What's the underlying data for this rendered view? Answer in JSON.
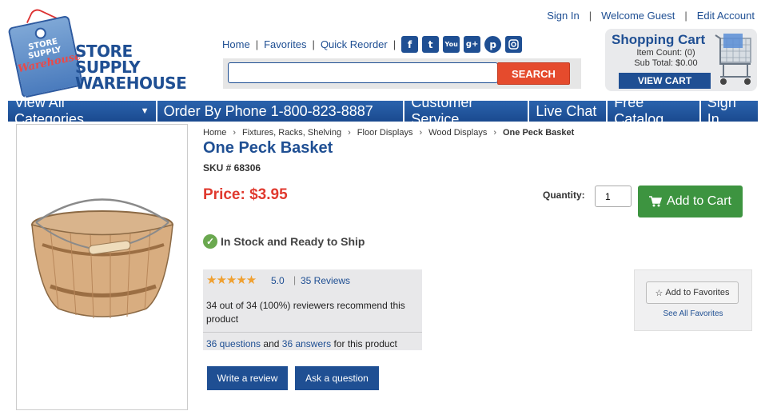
{
  "top_links": {
    "sign_in": "Sign In",
    "welcome": "Welcome Guest",
    "edit_account": "Edit Account"
  },
  "logo": {
    "tag_line1": "STORE SUPPLY",
    "tag_line2": "Warehouse",
    "name_line1": "STORE SUPPLY",
    "name_line2": "WAREHOUSE"
  },
  "mid_nav": {
    "home": "Home",
    "favorites": "Favorites",
    "quick_reorder": "Quick Reorder"
  },
  "social": [
    "facebook-icon",
    "twitter-icon",
    "youtube-icon",
    "googleplus-icon",
    "pinterest-icon",
    "instagram-icon"
  ],
  "search": {
    "placeholder": "",
    "button": "SEARCH"
  },
  "cart": {
    "title": "Shopping Cart",
    "item_count": "Item Count: (0)",
    "subtotal": "Sub Total: $0.00",
    "view_button": "VIEW CART"
  },
  "navbar": {
    "categories": "View All Categories",
    "phone": "Order By Phone 1-800-823-8887",
    "customer_service": "Customer Service",
    "live_chat": "Live Chat",
    "free_catalog": "Free Catalog",
    "sign_in": "Sign In"
  },
  "breadcrumb": [
    "Home",
    "Fixtures, Racks, Shelving",
    "Floor Displays",
    "Wood Displays",
    "One Peck Basket"
  ],
  "product": {
    "title": "One Peck Basket",
    "sku": "SKU # 68306",
    "price": "Price: $3.95",
    "quantity_label": "Quantity:",
    "quantity_value": "1",
    "add_to_cart": "Add to Cart",
    "stock": "In Stock and Ready to Ship"
  },
  "reviews": {
    "rating": "5.0",
    "stars_value": 5,
    "count": "35 Reviews",
    "recommend": "34 out of 34 (100%) reviewers recommend this product",
    "questions": "36 questions",
    "and": "and",
    "answers": "36 answers",
    "suffix": "for this product"
  },
  "actions": {
    "write_review": "Write a review",
    "ask_question": "Ask a question"
  },
  "favorites": {
    "add": "Add to Favorites",
    "see_all": "See All Favorites"
  },
  "colors": {
    "brand_blue": "#1f4f93",
    "price_red": "#e03a2f",
    "search_red": "#e54b2d",
    "cart_green": "#3d9440"
  }
}
